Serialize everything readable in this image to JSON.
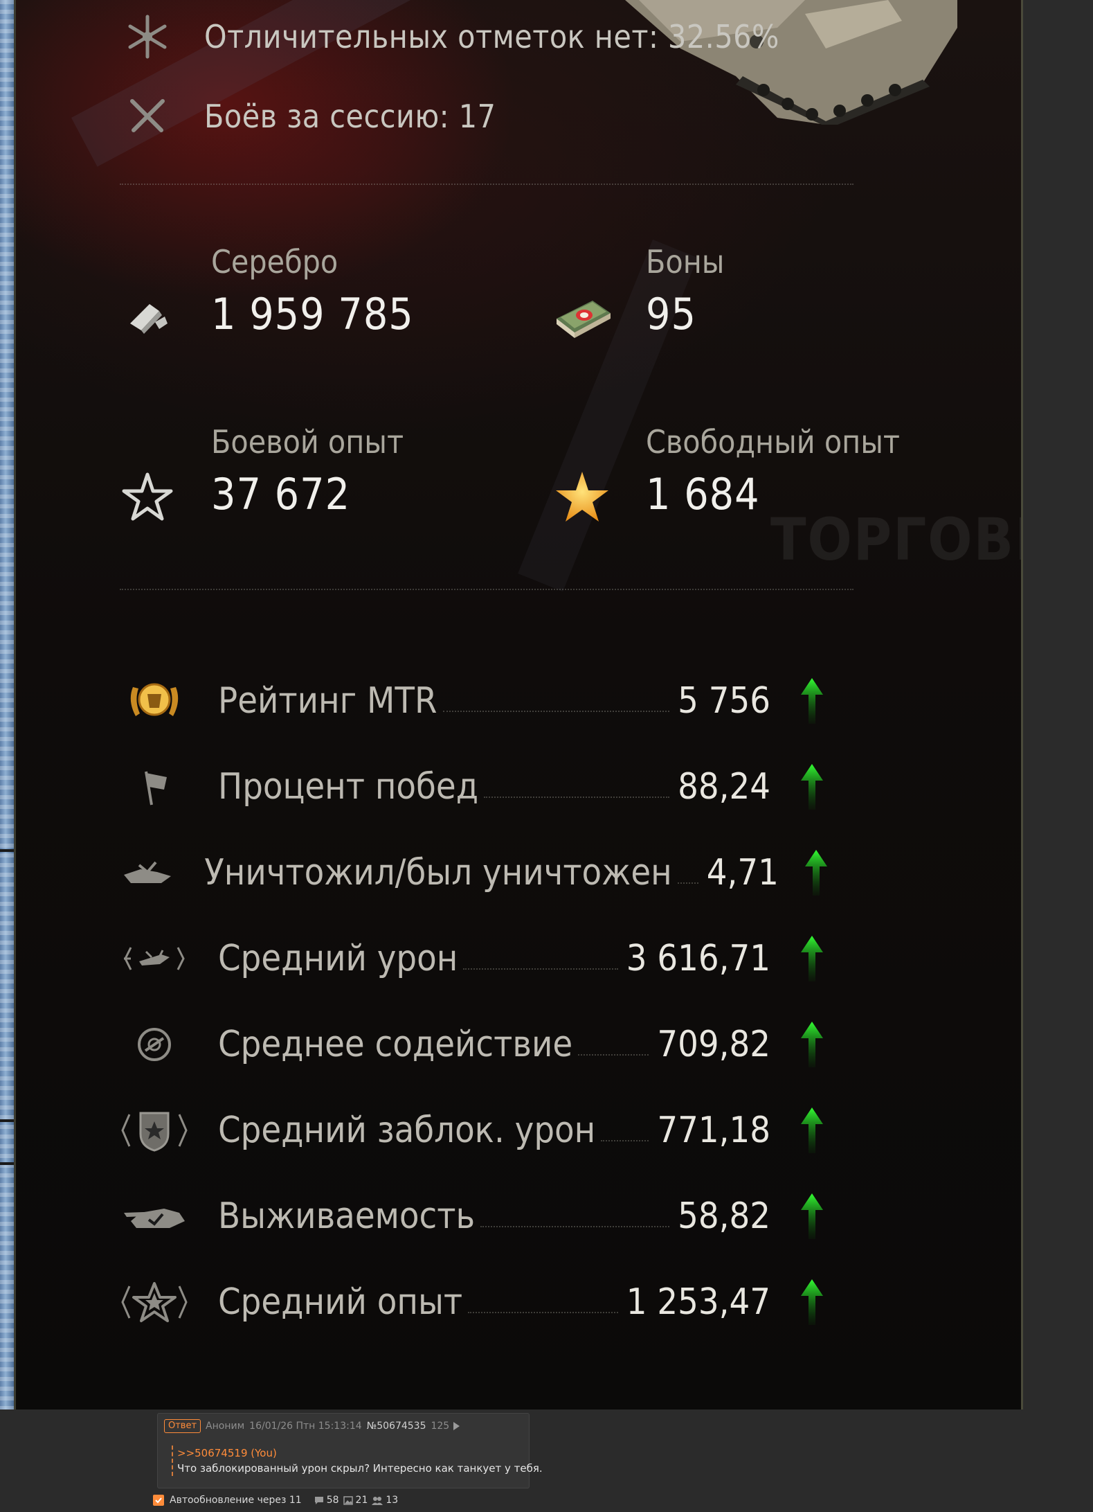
{
  "session": {
    "marks_text": "Отличительных отметок нет: 32.56%",
    "battles_text": "Боёв за сессию: 17"
  },
  "resources": {
    "silver": {
      "label": "Серебро",
      "value": "1 959 785",
      "icon": "silver-icon"
    },
    "bonds": {
      "label": "Боны",
      "value": "95",
      "icon": "bonds-icon"
    },
    "combat_xp": {
      "label": "Боевой опыт",
      "value": "37 672",
      "icon": "star-outline-icon"
    },
    "free_xp": {
      "label": "Свободный опыт",
      "value": "1 684",
      "icon": "star-gold-icon"
    }
  },
  "watermark": "ТОРГОВЫ",
  "stats": [
    {
      "name": "Рейтинг MTR",
      "value": "5 756",
      "icon": "mtr-rating-icon",
      "trend": "up"
    },
    {
      "name": "Процент побед",
      "value": "88,24",
      "icon": "flag-icon",
      "trend": "up"
    },
    {
      "name": "Уничтожил/был уничтожен",
      "value": "4,71",
      "icon": "destroyed-ratio-icon",
      "trend": "up"
    },
    {
      "name": "Средний урон",
      "value": "3 616,71",
      "icon": "damage-icon",
      "trend": "up"
    },
    {
      "name": "Среднее содействие",
      "value": "709,82",
      "icon": "assist-icon",
      "trend": "up"
    },
    {
      "name": "Средний заблок. урон",
      "value": "771,18",
      "icon": "blocked-damage-icon",
      "trend": "up"
    },
    {
      "name": "Выживаемость",
      "value": "58,82",
      "icon": "survival-icon",
      "trend": "up"
    },
    {
      "name": "Средний опыт",
      "value": "1 253,47",
      "icon": "avg-xp-icon",
      "trend": "up"
    }
  ],
  "colors": {
    "trend_up": "#1fe81f",
    "gold": "#f3b12e",
    "forum_accent": "#ff8c3a"
  },
  "post": {
    "reply_label": "Ответ",
    "author": "Аноним",
    "datetime": "16/01/26 Птн 15:13:14",
    "number": "№50674535",
    "count": "125",
    "quote": ">>50674519 (You)",
    "message": "Что заблокированный урон скрыл? Интересно как танкует у тебя."
  },
  "footer": {
    "autoupdate_label": "Автообновление через 11",
    "autoupdate_checked": true,
    "posts_count": "58",
    "images_count": "21",
    "users_count": "13"
  }
}
